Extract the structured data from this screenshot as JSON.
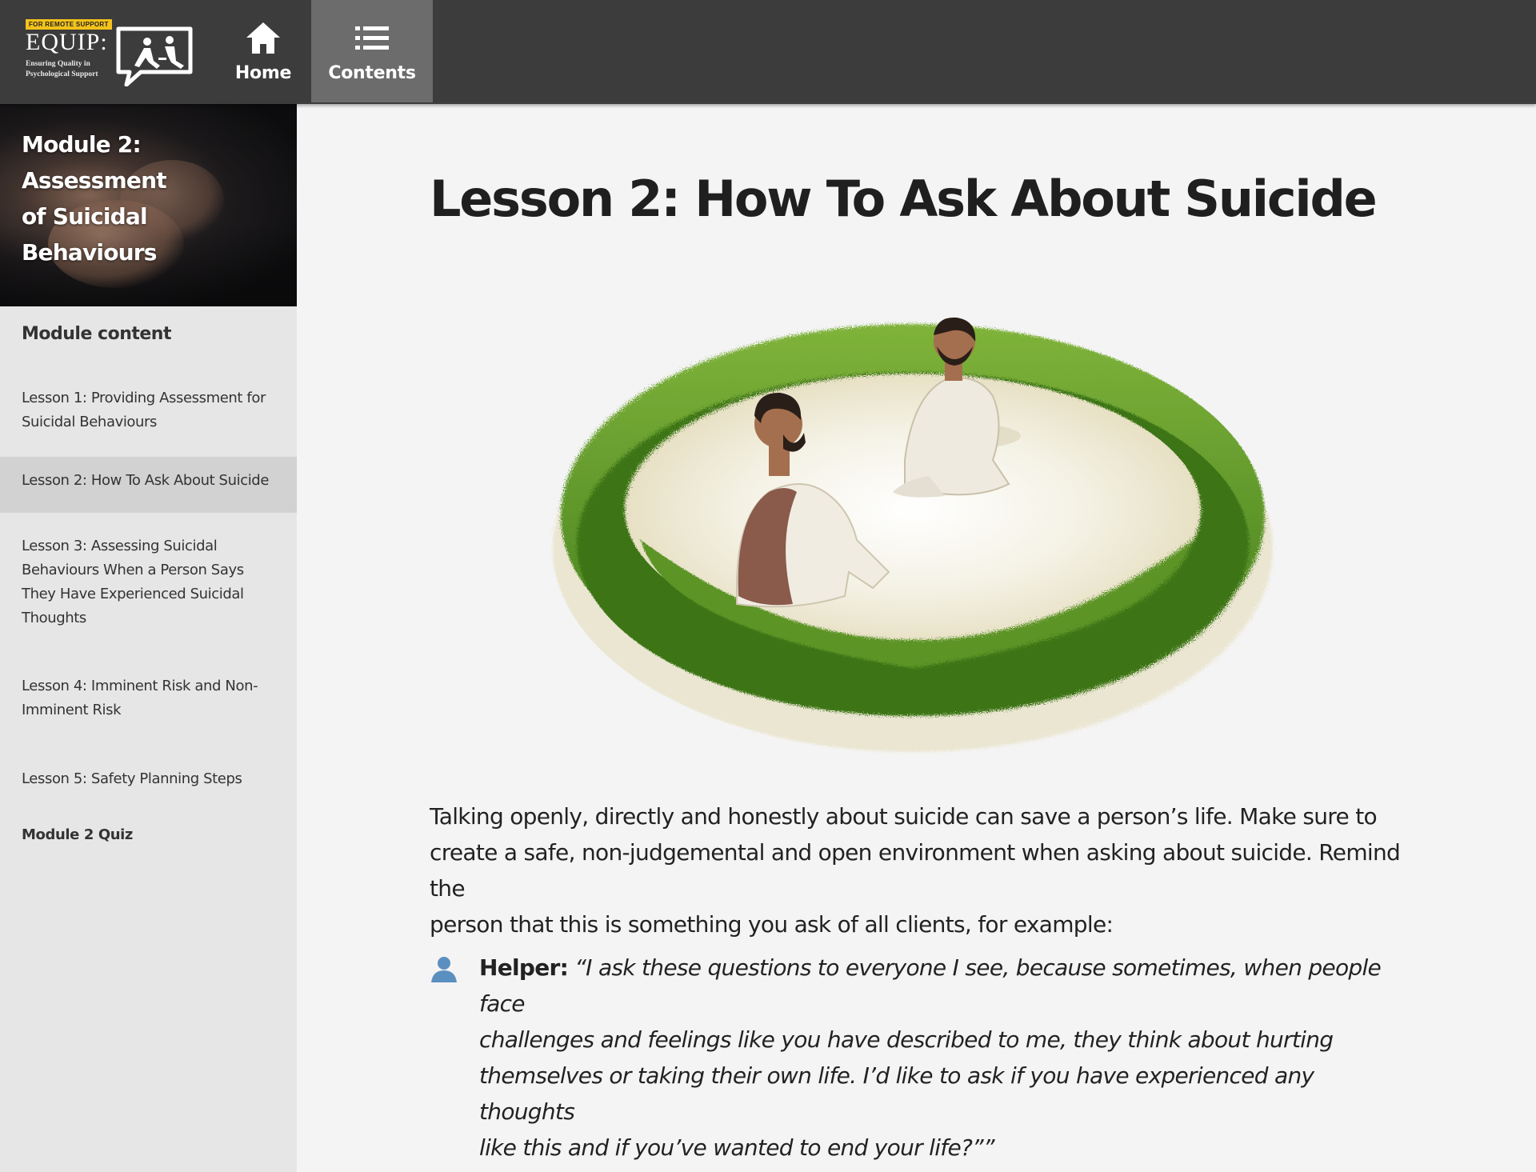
{
  "header": {
    "logo": {
      "tag": "FOR REMOTE SUPPORT",
      "name": "EQUIP:",
      "subtitle_line1": "Ensuring Quality in",
      "subtitle_line2": "Psychological Support"
    },
    "nav": [
      {
        "label": "Home",
        "icon": "home-icon"
      },
      {
        "label": "Contents",
        "icon": "list-icon",
        "active": true
      }
    ]
  },
  "sidebar": {
    "module_title_line1": "Module 2: Assessment",
    "module_title_line2": "of Suicidal Behaviours",
    "section_title": "Module content",
    "lessons": [
      {
        "label_lines": [
          "Lesson 1: Providing Assessment for",
          "Suicidal Behaviours"
        ]
      },
      {
        "label_lines": [
          "Lesson 2: How To Ask About Suicide"
        ],
        "active": true
      },
      {
        "label_lines": [
          "Lesson 3: Assessing Suicidal",
          "Behaviours When a Person Says",
          "They Have Experienced Suicidal",
          "Thoughts"
        ]
      },
      {
        "label_lines": [
          "Lesson 4: Imminent Risk and Non-",
          "Imminent Risk"
        ]
      },
      {
        "label_lines": [
          "Lesson 5: Safety Planning Steps"
        ]
      }
    ],
    "quiz_label": "Module 2 Quiz"
  },
  "main": {
    "title": "Lesson 2: How To Ask About Suicide",
    "intro_lines": [
      "Talking openly, directly and honestly about suicide can save a person’s life. Make sure to",
      "create a safe, non-judgemental and open environment when asking about suicide. Remind the",
      "person that this is something you ask of all clients, for example:"
    ],
    "quote": {
      "speaker": "Helper:",
      "lines": [
        "“I ask these questions to everyone I see, because sometimes, when people face",
        "challenges and feelings like you have described to me, they think about hurting",
        "themselves or taking their own life. I’d like to ask if you have experienced any thoughts",
        "like this and if you’ve wanted to end your life?””"
      ]
    }
  },
  "colors": {
    "topbar": "#3c3c3c",
    "nav_active": "#6c6c6c",
    "sidebar_bg": "#e6e6e6",
    "sidebar_active": "#d2d2d2",
    "main_bg": "#f4f4f4",
    "logo_tag": "#f3c21b",
    "user_icon": "#5b8fc0",
    "grass": "#4f8a22"
  }
}
